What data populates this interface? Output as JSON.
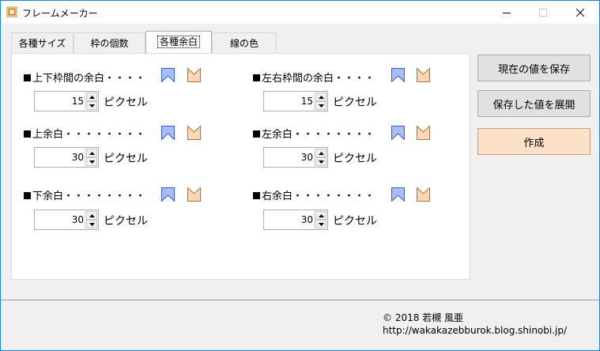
{
  "window": {
    "title": "フレームメーカー"
  },
  "titlebar_buttons": {
    "minimize": "—",
    "maximize": "☐",
    "close": "✕"
  },
  "tabs": [
    {
      "label": "各種サイズ"
    },
    {
      "label": "枠の個数"
    },
    {
      "label": "各種余白",
      "active": true
    },
    {
      "label": "線の色"
    }
  ],
  "margins": {
    "inner_vertical": {
      "heading": "上下枠間の余白・・・・",
      "value": "15",
      "unit": "ピクセル"
    },
    "inner_horizontal": {
      "heading": "左右枠間の余白・・・・",
      "value": "15",
      "unit": "ピクセル"
    },
    "top": {
      "heading": "上余白・・・・・・・・",
      "value": "30",
      "unit": "ピクセル"
    },
    "left": {
      "heading": "左余白・・・・・・・・",
      "value": "30",
      "unit": "ピクセル"
    },
    "bottom": {
      "heading": "下余白・・・・・・・・",
      "value": "30",
      "unit": "ピクセル"
    },
    "right": {
      "heading": "右余白・・・・・・・・",
      "value": "30",
      "unit": "ピクセル"
    }
  },
  "buttons": {
    "save_current": "現在の値を保存",
    "load_saved": "保存した値を展開",
    "create": "作成"
  },
  "footer": {
    "copyright": "© 2018 若槻 風亜",
    "url": "http://wakakazebburok.blog.shinobi.jp/"
  },
  "colors": {
    "flag_blue": "#a8bdf5",
    "flag_orange": "#fdd7b8",
    "create_button": "#fde0c8"
  },
  "icons": {
    "app": "frame-app-icon",
    "down_flag": "bookmark-flag-icon",
    "up_flag": "notch-flag-icon"
  }
}
